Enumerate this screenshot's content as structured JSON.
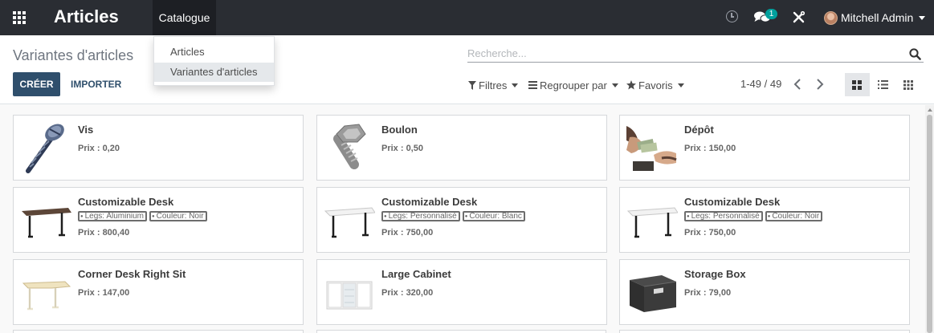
{
  "navbar": {
    "app_title": "Articles",
    "menu_catalogue": "Catalogue",
    "messages_badge": "1",
    "user_name": "Mitchell Admin"
  },
  "dropdown": {
    "items": [
      "Articles",
      "Variantes d'articles"
    ]
  },
  "control_panel": {
    "breadcrumb": "Variantes d'articles",
    "create_label": "CRÉER",
    "import_label": "IMPORTER",
    "search_placeholder": "Recherche...",
    "filters_label": "Filtres",
    "group_by_label": "Regrouper par",
    "favorites_label": "Favoris",
    "pager": "1-49 / 49"
  },
  "cards": [
    {
      "name": "Vis",
      "price": "Prix : 0,20",
      "tags": [],
      "icon": "screw-image"
    },
    {
      "name": "Boulon",
      "price": "Prix : 0,50",
      "tags": [],
      "icon": "bolt-image"
    },
    {
      "name": "Dépôt",
      "price": "Prix : 150,00",
      "tags": [],
      "icon": "money-hands-image"
    },
    {
      "name": "Customizable Desk",
      "price": "Prix : 800,40",
      "tags": [
        "Legs: Aluminium",
        "Couleur: Noir"
      ],
      "icon": "dark-desk-image"
    },
    {
      "name": "Customizable Desk",
      "price": "Prix : 750,00",
      "tags": [
        "Legs: Personnalisé",
        "Couleur: Blanc"
      ],
      "icon": "white-desk-image"
    },
    {
      "name": "Customizable Desk",
      "price": "Prix : 750,00",
      "tags": [
        "Legs: Personnalisé",
        "Couleur: Noir"
      ],
      "icon": "white-desk-image"
    },
    {
      "name": "Corner Desk Right Sit",
      "price": "Prix : 147,00",
      "tags": [],
      "icon": "corner-desk-image"
    },
    {
      "name": "Large Cabinet",
      "price": "Prix : 320,00",
      "tags": [],
      "icon": "cabinet-image"
    },
    {
      "name": "Storage Box",
      "price": "Prix : 79,00",
      "tags": [],
      "icon": "storage-box-image"
    }
  ]
}
